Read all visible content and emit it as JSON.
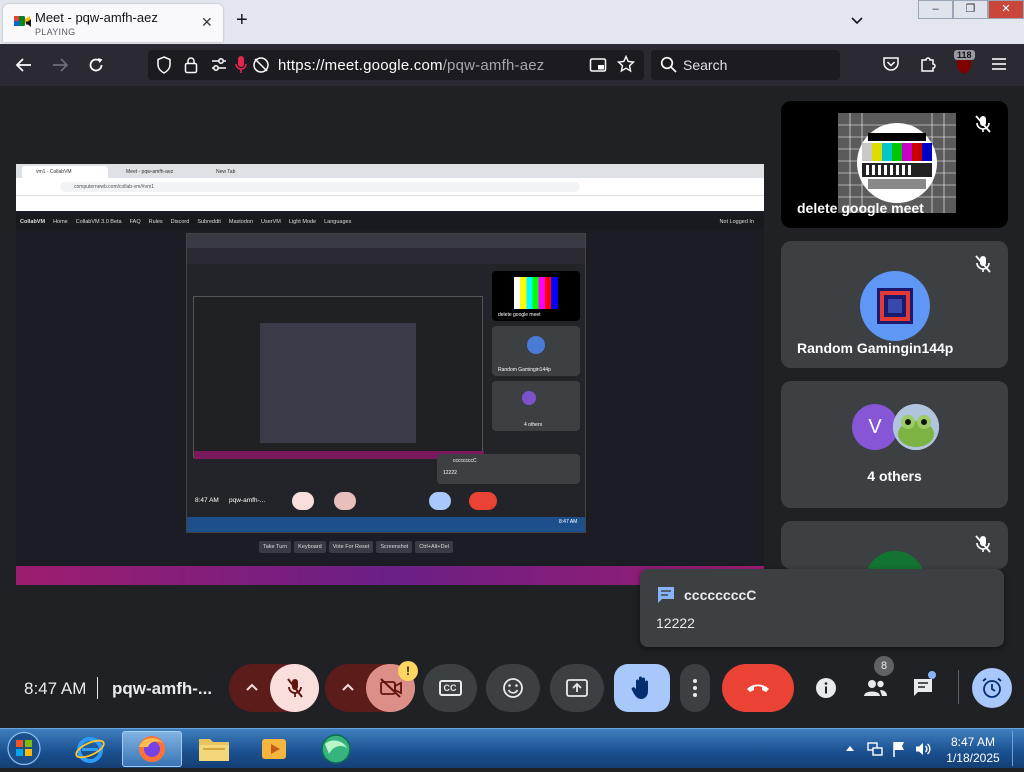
{
  "browser": {
    "tab_title": "Meet - pqw-amfh-aez",
    "tab_status": "PLAYING",
    "url_host": "https://meet.google.com",
    "url_path": "/pqw-amfh-aez",
    "search_placeholder": "Search",
    "extensions_badge": "118",
    "window_controls": [
      "–",
      "❐",
      "✕"
    ]
  },
  "shared_screen": {
    "mini_tab": "vm1 - CollabVM",
    "mini_tab2": "Meet - pqw-amfh-aez",
    "mini_tab3": "New Tab",
    "mini_url": "computernewb.com/collab-vm/#vm1",
    "site_title": "CollabVM",
    "menu": [
      "Home",
      "CollabVM 3.0 Beta",
      "FAQ",
      "Rules",
      "Discord",
      "Subreddit",
      "Mastodon",
      "UserVM",
      "Light Mode",
      "Languages"
    ],
    "not_logged": "Not Logged In",
    "inner_time": "8:47 AM",
    "inner_code": "pqw-amfh-...",
    "inner_tile1": "delete google meet",
    "inner_tile2": "Random Gamingin144p",
    "inner_tile3": "4 others",
    "inner_chat_sender": "ccccccccC",
    "inner_chat_msg": "12222",
    "vm_buttons": [
      "Take Turn",
      "Keyboard",
      "Vote For Reset",
      "Screenshot",
      "Ctrl+Alt+Del"
    ],
    "inner_clock": "8:47 AM"
  },
  "participants": [
    {
      "name": "delete google meet"
    },
    {
      "name": "Random Gamingin144p"
    },
    {
      "name": "4 others",
      "avatar_letter": "V"
    },
    {
      "name": ""
    }
  ],
  "toast": {
    "sender": "ccccccccC",
    "message": "12222"
  },
  "controls": {
    "time": "8:47 AM",
    "meeting_code": "pqw-amfh-...",
    "people_count": "8",
    "captions_label": "CC",
    "camera_warning": "!"
  },
  "taskbar": {
    "clock_time": "8:47 AM",
    "clock_date": "1/18/2025"
  },
  "colors": {
    "end_call": "#ea4335",
    "mic_muted_bg": "#f9dedc",
    "raised_hand": "#a8c7fa",
    "accent_blue": "#8ab4f8"
  }
}
